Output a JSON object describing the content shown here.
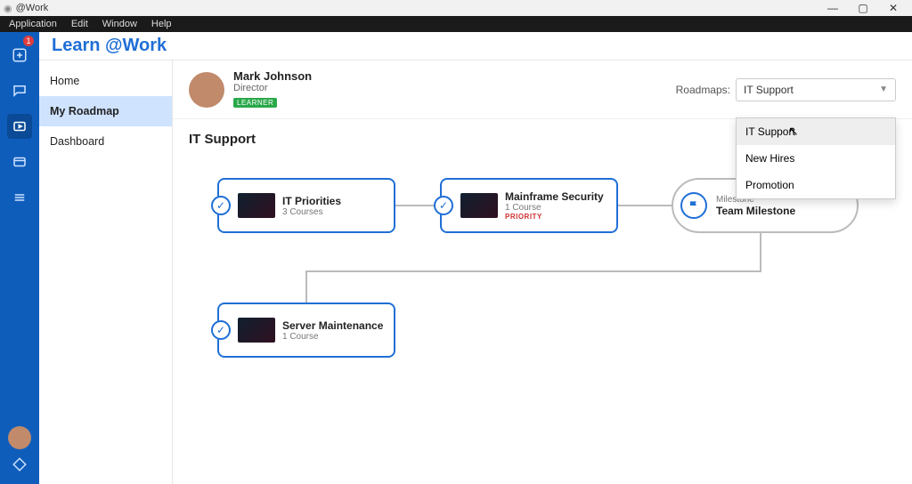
{
  "window": {
    "title": "@Work"
  },
  "menu": {
    "items": [
      "Application",
      "Edit",
      "Window",
      "Help"
    ]
  },
  "rail": {
    "badge": "1"
  },
  "app_title": "Learn @Work",
  "left_nav": {
    "items": [
      {
        "label": "Home",
        "active": false
      },
      {
        "label": "My Roadmap",
        "active": true
      },
      {
        "label": "Dashboard",
        "active": false
      }
    ]
  },
  "profile": {
    "name": "Mark Johnson",
    "role": "Director",
    "tag": "LEARNER"
  },
  "roadmap_selector": {
    "label": "Roadmaps:",
    "selected": "IT Support",
    "options": [
      "IT Support",
      "New Hires",
      "Promotion"
    ]
  },
  "section_title": "IT Support",
  "cards": {
    "it_priorities": {
      "title": "IT Priorities",
      "subtitle": "3 Courses"
    },
    "mainframe": {
      "title": "Mainframe Security",
      "subtitle": "1 Course",
      "priority": "PRIORITY"
    },
    "server": {
      "title": "Server Maintenance",
      "subtitle": "1 Course"
    }
  },
  "milestone": {
    "label": "Milestone",
    "title": "Team Milestone"
  }
}
